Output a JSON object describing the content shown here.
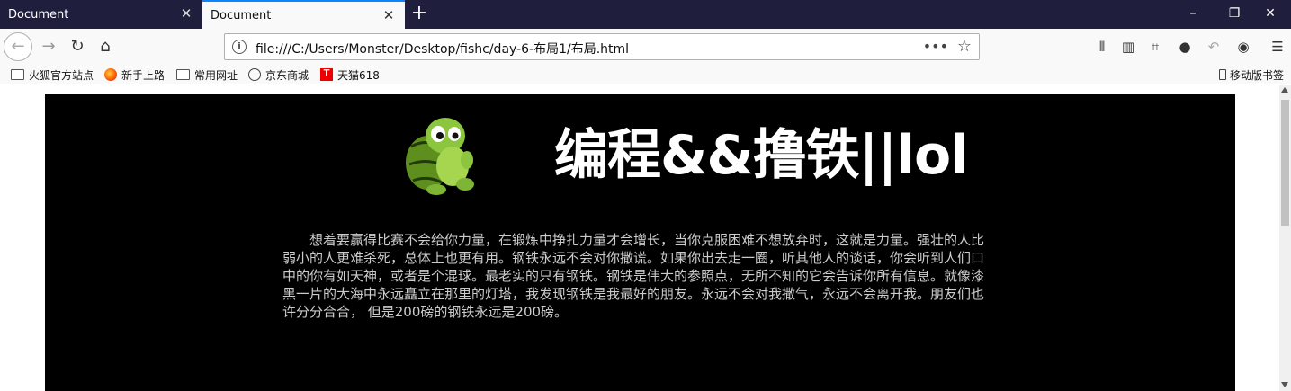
{
  "tabs": [
    {
      "title": "Document",
      "active": false
    },
    {
      "title": "Document",
      "active": true
    }
  ],
  "window_controls": {
    "minimize": "–",
    "restore": "❐",
    "close": "✕"
  },
  "navbar": {
    "url": "file:///C:/Users/Monster/Desktop/fishc/day-6-布局1/布局.html",
    "page_actions": "•••"
  },
  "bookmarks": [
    {
      "label": "火狐官方站点",
      "icon": "folder-icon"
    },
    {
      "label": "新手上路",
      "icon": "firefox-icon"
    },
    {
      "label": "常用网址",
      "icon": "folder-icon"
    },
    {
      "label": "京东商城",
      "icon": "globe-icon"
    },
    {
      "label": "天猫618",
      "icon": "tmall-icon"
    }
  ],
  "mobile_bookmarks": "移动版书签",
  "page": {
    "headline": "编程&&撸铁||lol",
    "paragraph": "想着要赢得比赛不会给你力量，在锻炼中挣扎力量才会增长，当你克服困难不想放弃时，这就是力量。强壮的人比弱小的人更难杀死，总体上也更有用。钢铁永远不会对你撒谎。如果你出去走一圈，听其他人的谈话，你会听到人们口中的你有如天神，或者是个混球。最老实的只有钢铁。钢铁是伟大的参照点，无所不知的它会告诉你所有信息。就像漆黑一片的大海中永远矗立在那里的灯塔，我发现钢铁是我最好的朋友。永远不会对我撒气，永远不会离开我。朋友们也许分分合合， 但是200磅的钢铁永远是200磅。"
  },
  "colors": {
    "tabbar": "#1f1f3d",
    "accent": "#0a84ff",
    "content_bg": "#000000"
  }
}
